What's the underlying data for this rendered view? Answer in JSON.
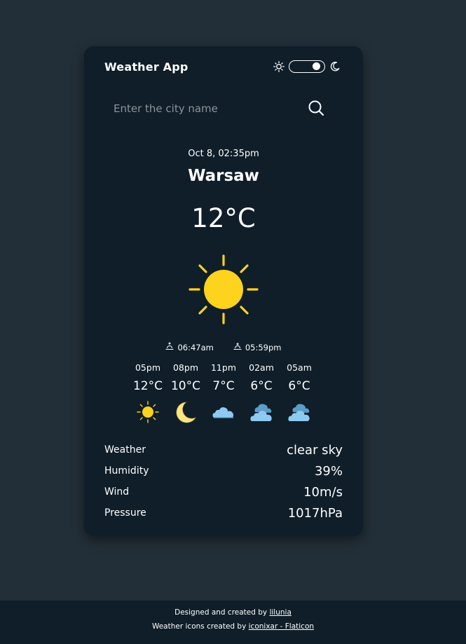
{
  "app": {
    "title": "Weather App"
  },
  "theme": {
    "mode": "dark",
    "sun_icon": "sun-outline-icon",
    "moon_icon": "moon-icon"
  },
  "search": {
    "placeholder": "Enter the city name",
    "value": ""
  },
  "current": {
    "datetime": "Oct 8, 02:35pm",
    "city": "Warsaw",
    "temperature": "12°C",
    "icon": "sun-icon",
    "sunrise": "06:47am",
    "sunset": "05:59pm"
  },
  "forecast": [
    {
      "time": "05pm",
      "temp": "12°C",
      "icon": "sun-icon"
    },
    {
      "time": "08pm",
      "temp": "10°C",
      "icon": "moon-icon"
    },
    {
      "time": "11pm",
      "temp": "7°C",
      "icon": "cloud-icon"
    },
    {
      "time": "02am",
      "temp": "6°C",
      "icon": "clouds-icon"
    },
    {
      "time": "05am",
      "temp": "6°C",
      "icon": "clouds-icon"
    }
  ],
  "details": [
    {
      "label": "Weather",
      "value": "clear sky"
    },
    {
      "label": "Humidity",
      "value": "39%"
    },
    {
      "label": "Wind",
      "value": "10m/s"
    },
    {
      "label": "Pressure",
      "value": "1017hPa"
    }
  ],
  "footer": {
    "line1_prefix": "Designed and created by ",
    "line1_link": "lilunia",
    "line2_prefix": "Weather icons created by ",
    "line2_link": "iconixar - Flaticon"
  },
  "colors": {
    "background": "#232f38",
    "card": "#0f1e29",
    "sun": "#fdd31d",
    "moon": "#fde47f",
    "cloud": "#8ec9f1"
  }
}
